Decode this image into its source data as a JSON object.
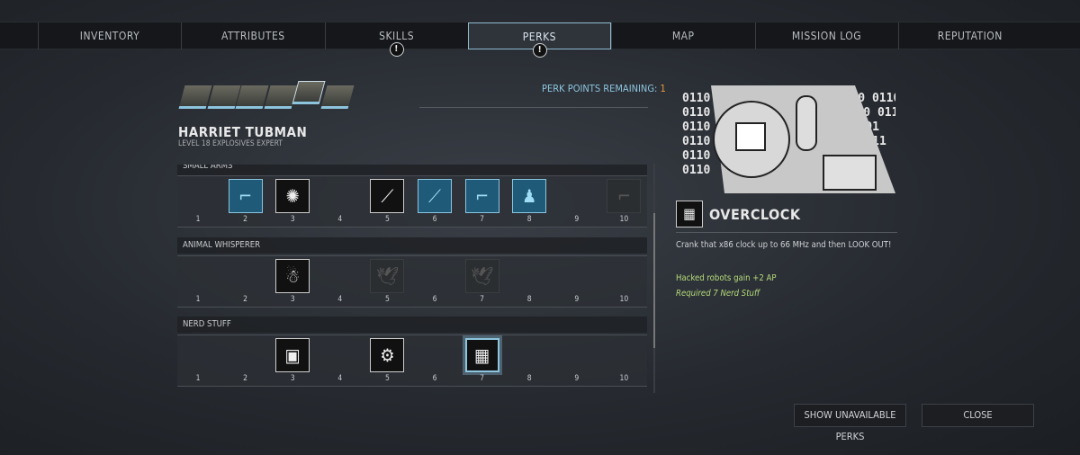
{
  "tabs": [
    {
      "label": "INVENTORY"
    },
    {
      "label": "ATTRIBUTES"
    },
    {
      "label": "SKILLS",
      "alert": true
    },
    {
      "label": "PERKS",
      "alert": true,
      "selected": true
    },
    {
      "label": "MAP"
    },
    {
      "label": "MISSION LOG"
    },
    {
      "label": "REPUTATION"
    }
  ],
  "alert_glyph": "!",
  "character": {
    "name": "HARRIET TUBMAN",
    "subtitle": "LEVEL 18 EXPLOSIVES EXPERT",
    "portraits": 6,
    "selected_portrait": 5
  },
  "perk_points": {
    "label": "PERK POINTS REMAINING:",
    "value": "1"
  },
  "columns": [
    "1",
    "2",
    "3",
    "4",
    "5",
    "6",
    "7",
    "8",
    "9",
    "10"
  ],
  "trees": [
    {
      "name": "SMALL ARMS",
      "perks": [
        {
          "col": 2,
          "state": "active",
          "icon": "gun-icon"
        },
        {
          "col": 3,
          "state": "available",
          "icon": "bullet-icon"
        },
        {
          "col": 5,
          "state": "available",
          "icon": "rifle-icon"
        },
        {
          "col": 6,
          "state": "active",
          "icon": "rifle-icon"
        },
        {
          "col": 7,
          "state": "active",
          "icon": "pistol-icon"
        },
        {
          "col": 8,
          "state": "active",
          "icon": "squad-icon"
        },
        {
          "col": 10,
          "state": "unavailable",
          "icon": "gun-icon"
        }
      ]
    },
    {
      "name": "ANIMAL WHISPERER",
      "perks": [
        {
          "col": 3,
          "state": "available",
          "icon": "seal-icon"
        },
        {
          "col": 5,
          "state": "unavailable",
          "icon": "bird-icon"
        },
        {
          "col": 7,
          "state": "unavailable",
          "icon": "bird-icon"
        }
      ]
    },
    {
      "name": "NERD STUFF",
      "perks": [
        {
          "col": 3,
          "state": "available",
          "icon": "computer-icon"
        },
        {
          "col": 5,
          "state": "available",
          "icon": "robot-icon"
        },
        {
          "col": 7,
          "state": "selected",
          "icon": "chip-icon"
        }
      ]
    }
  ],
  "detail": {
    "title": "OVERCLOCK",
    "description": "Crank that x86 clock up to 66 MHz and then LOOK OUT!",
    "effect": "Hacked robots gain +2 AP",
    "requirement": "Required 7 Nerd Stuff",
    "effect_color": "#b6dc7a"
  },
  "buttons": {
    "show_unavailable": "SHOW UNAVAILABLE PERKS",
    "close": "CLOSE"
  },
  "colors": {
    "accent": "#8cc4de",
    "points": "#e79a3b"
  }
}
